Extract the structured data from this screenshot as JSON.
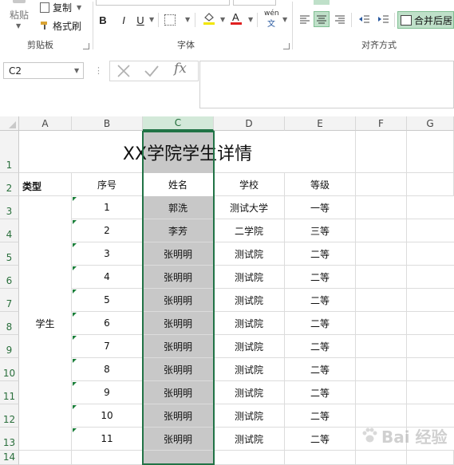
{
  "ribbon": {
    "clipboard": {
      "paste_label": "粘贴",
      "copy_label": "复制",
      "format_painter_label": "格式刷",
      "group_label": "剪贴板"
    },
    "font": {
      "bold": "B",
      "italic": "I",
      "underline": "U",
      "phonetic_top": "wén",
      "phonetic_bottom": "文",
      "font_color_letter": "A",
      "group_label": "字体"
    },
    "alignment": {
      "merge_center_label": "合并后居",
      "group_label": "对齐方式"
    }
  },
  "formula_bar": {
    "name_box_value": "C2",
    "fx_label": "fx",
    "formula_value": ""
  },
  "columns": [
    "A",
    "B",
    "C",
    "D",
    "E",
    "F",
    "G"
  ],
  "rows": [
    "1",
    "2",
    "3",
    "4",
    "5",
    "6",
    "7",
    "8",
    "9",
    "10",
    "11",
    "12",
    "13",
    "14"
  ],
  "sheet": {
    "title": "XX学院学生详情",
    "headers": {
      "type": "类型",
      "number": "序号",
      "name": "姓名",
      "school": "学校",
      "grade": "等级"
    },
    "type_value": "学生",
    "records": [
      {
        "no": "1",
        "name": "郭洗",
        "school": "测试大学",
        "grade": "一等"
      },
      {
        "no": "2",
        "name": "李芳",
        "school": "二学院",
        "grade": "三等"
      },
      {
        "no": "3",
        "name": "张明明",
        "school": "测试院",
        "grade": "二等"
      },
      {
        "no": "4",
        "name": "张明明",
        "school": "测试院",
        "grade": "二等"
      },
      {
        "no": "5",
        "name": "张明明",
        "school": "测试院",
        "grade": "二等"
      },
      {
        "no": "6",
        "name": "张明明",
        "school": "测试院",
        "grade": "二等"
      },
      {
        "no": "7",
        "name": "张明明",
        "school": "测试院",
        "grade": "二等"
      },
      {
        "no": "8",
        "name": "张明明",
        "school": "测试院",
        "grade": "二等"
      },
      {
        "no": "9",
        "name": "张明明",
        "school": "测试院",
        "grade": "二等"
      },
      {
        "no": "10",
        "name": "张明明",
        "school": "测试院",
        "grade": "二等"
      },
      {
        "no": "11",
        "name": "张明明",
        "school": "测试院",
        "grade": "二等"
      }
    ]
  },
  "watermark": {
    "text": "Bai 经验"
  }
}
